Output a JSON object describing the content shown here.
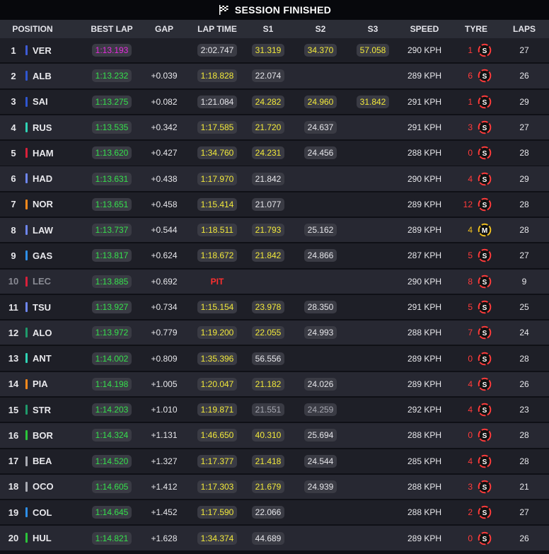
{
  "title": "SESSION FINISHED",
  "icons": {
    "title": "checkered-flag-icon",
    "tyre": "tyre-compound-icon"
  },
  "colors": {
    "best_overall": "#e92ae0",
    "personal_best": "#35e04c",
    "improved": "#f2e93a",
    "pit": "#ff2f2f",
    "soft": "#ff3b3b",
    "medium": "#f0c020"
  },
  "columns": {
    "position": "POSITION",
    "best_lap": "BEST LAP",
    "gap": "GAP",
    "lap_time": "LAP TIME",
    "s1": "S1",
    "s2": "S2",
    "s3": "S3",
    "speed": "SPEED",
    "tyre": "TYRE",
    "laps": "LAPS"
  },
  "rows": [
    {
      "pos": "1",
      "team": "#3e5bd6",
      "driver": "VER",
      "best": "1:13.193",
      "best_c": "purple",
      "gap": "",
      "lap": "2:02.747",
      "lap_c": "white",
      "s1": "31.319",
      "s1_c": "yellow",
      "s2": "34.370",
      "s2_c": "yellow",
      "s3": "57.058",
      "s3_c": "yellow",
      "speed": "290 KPH",
      "tyre_count": "1",
      "tyre": "S",
      "laps": "27"
    },
    {
      "pos": "2",
      "team": "#2f56d0",
      "driver": "ALB",
      "best": "1:13.232",
      "best_c": "green",
      "gap": "+0.039",
      "lap": "1:18.828",
      "lap_c": "yellow",
      "s1": "22.074",
      "s1_c": "white",
      "s2": "",
      "s2_c": "white",
      "s3": "",
      "s3_c": "white",
      "speed": "289 KPH",
      "tyre_count": "6",
      "tyre": "S",
      "laps": "26"
    },
    {
      "pos": "3",
      "team": "#2f56d0",
      "driver": "SAI",
      "best": "1:13.275",
      "best_c": "green",
      "gap": "+0.082",
      "lap": "1:21.084",
      "lap_c": "white",
      "s1": "24.282",
      "s1_c": "yellow",
      "s2": "24.960",
      "s2_c": "yellow",
      "s3": "31.842",
      "s3_c": "yellow",
      "speed": "291 KPH",
      "tyre_count": "1",
      "tyre": "S",
      "laps": "29"
    },
    {
      "pos": "4",
      "team": "#2fd3b5",
      "driver": "RUS",
      "best": "1:13.535",
      "best_c": "green",
      "gap": "+0.342",
      "lap": "1:17.585",
      "lap_c": "yellow",
      "s1": "21.720",
      "s1_c": "yellow",
      "s2": "24.637",
      "s2_c": "white",
      "s3": "",
      "s3_c": "white",
      "speed": "291 KPH",
      "tyre_count": "3",
      "tyre": "S",
      "laps": "27"
    },
    {
      "pos": "5",
      "team": "#d8203a",
      "driver": "HAM",
      "best": "1:13.620",
      "best_c": "green",
      "gap": "+0.427",
      "lap": "1:34.760",
      "lap_c": "yellow",
      "s1": "24.231",
      "s1_c": "yellow",
      "s2": "24.456",
      "s2_c": "white",
      "s3": "",
      "s3_c": "white",
      "speed": "288 KPH",
      "tyre_count": "0",
      "tyre": "S",
      "laps": "28"
    },
    {
      "pos": "6",
      "team": "#6e86ee",
      "driver": "HAD",
      "best": "1:13.631",
      "best_c": "green",
      "gap": "+0.438",
      "lap": "1:17.970",
      "lap_c": "yellow",
      "s1": "21.842",
      "s1_c": "white",
      "s2": "",
      "s2_c": "white",
      "s3": "",
      "s3_c": "white",
      "speed": "290 KPH",
      "tyre_count": "4",
      "tyre": "S",
      "laps": "29"
    },
    {
      "pos": "7",
      "team": "#ff8a1c",
      "driver": "NOR",
      "best": "1:13.651",
      "best_c": "green",
      "gap": "+0.458",
      "lap": "1:15.414",
      "lap_c": "yellow",
      "s1": "21.077",
      "s1_c": "white",
      "s2": "",
      "s2_c": "white",
      "s3": "",
      "s3_c": "white",
      "speed": "289 KPH",
      "tyre_count": "12",
      "tyre": "S",
      "laps": "28"
    },
    {
      "pos": "8",
      "team": "#6e86ee",
      "driver": "LAW",
      "best": "1:13.737",
      "best_c": "green",
      "gap": "+0.544",
      "lap": "1:18.511",
      "lap_c": "yellow",
      "s1": "21.793",
      "s1_c": "yellow",
      "s2": "25.162",
      "s2_c": "white",
      "s3": "",
      "s3_c": "white",
      "speed": "289 KPH",
      "tyre_count": "4",
      "tyre": "M",
      "laps": "28"
    },
    {
      "pos": "9",
      "team": "#2e8fe8",
      "driver": "GAS",
      "best": "1:13.817",
      "best_c": "green",
      "gap": "+0.624",
      "lap": "1:18.672",
      "lap_c": "yellow",
      "s1": "21.842",
      "s1_c": "yellow",
      "s2": "24.866",
      "s2_c": "white",
      "s3": "",
      "s3_c": "white",
      "speed": "287 KPH",
      "tyre_count": "5",
      "tyre": "S",
      "laps": "27"
    },
    {
      "pos": "10",
      "team": "#d8203a",
      "driver": "LEC",
      "best": "1:13.885",
      "best_c": "green",
      "gap": "+0.692",
      "lap": "PIT",
      "lap_c": "red",
      "s1": "",
      "s1_c": "white",
      "s2": "",
      "s2_c": "white",
      "s3": "",
      "s3_c": "white",
      "speed": "290 KPH",
      "tyre_count": "8",
      "tyre": "S",
      "laps": "9",
      "out": true
    },
    {
      "pos": "11",
      "team": "#6e86ee",
      "driver": "TSU",
      "best": "1:13.927",
      "best_c": "green",
      "gap": "+0.734",
      "lap": "1:15.154",
      "lap_c": "yellow",
      "s1": "23.978",
      "s1_c": "yellow",
      "s2": "28.350",
      "s2_c": "white",
      "s3": "",
      "s3_c": "white",
      "speed": "291 KPH",
      "tyre_count": "5",
      "tyre": "S",
      "laps": "25"
    },
    {
      "pos": "12",
      "team": "#1f9a6b",
      "driver": "ALO",
      "best": "1:13.972",
      "best_c": "green",
      "gap": "+0.779",
      "lap": "1:19.200",
      "lap_c": "yellow",
      "s1": "22.055",
      "s1_c": "yellow",
      "s2": "24.993",
      "s2_c": "white",
      "s3": "",
      "s3_c": "white",
      "speed": "288 KPH",
      "tyre_count": "7",
      "tyre": "S",
      "laps": "24"
    },
    {
      "pos": "13",
      "team": "#2fd3b5",
      "driver": "ANT",
      "best": "1:14.002",
      "best_c": "green",
      "gap": "+0.809",
      "lap": "1:35.396",
      "lap_c": "yellow",
      "s1": "56.556",
      "s1_c": "white",
      "s2": "",
      "s2_c": "white",
      "s3": "",
      "s3_c": "white",
      "speed": "289 KPH",
      "tyre_count": "0",
      "tyre": "S",
      "laps": "28"
    },
    {
      "pos": "14",
      "team": "#ff8a1c",
      "driver": "PIA",
      "best": "1:14.198",
      "best_c": "green",
      "gap": "+1.005",
      "lap": "1:20.047",
      "lap_c": "yellow",
      "s1": "21.182",
      "s1_c": "yellow",
      "s2": "24.026",
      "s2_c": "white",
      "s3": "",
      "s3_c": "white",
      "speed": "289 KPH",
      "tyre_count": "4",
      "tyre": "S",
      "laps": "26"
    },
    {
      "pos": "15",
      "team": "#1f9a6b",
      "driver": "STR",
      "best": "1:14.203",
      "best_c": "green",
      "gap": "+1.010",
      "lap": "1:19.871",
      "lap_c": "yellow",
      "s1": "21.551",
      "s1_c": "grey",
      "s2": "24.259",
      "s2_c": "grey",
      "s3": "",
      "s3_c": "white",
      "speed": "292 KPH",
      "tyre_count": "4",
      "tyre": "S",
      "laps": "23"
    },
    {
      "pos": "16",
      "team": "#2bc43a",
      "driver": "BOR",
      "best": "1:14.324",
      "best_c": "green",
      "gap": "+1.131",
      "lap": "1:46.650",
      "lap_c": "yellow",
      "s1": "40.310",
      "s1_c": "yellow",
      "s2": "25.694",
      "s2_c": "white",
      "s3": "",
      "s3_c": "white",
      "speed": "288 KPH",
      "tyre_count": "0",
      "tyre": "S",
      "laps": "28"
    },
    {
      "pos": "17",
      "team": "#a9abb3",
      "driver": "BEA",
      "best": "1:14.520",
      "best_c": "green",
      "gap": "+1.327",
      "lap": "1:17.377",
      "lap_c": "yellow",
      "s1": "21.418",
      "s1_c": "yellow",
      "s2": "24.544",
      "s2_c": "white",
      "s3": "",
      "s3_c": "white",
      "speed": "285 KPH",
      "tyre_count": "4",
      "tyre": "S",
      "laps": "28"
    },
    {
      "pos": "18",
      "team": "#a9abb3",
      "driver": "OCO",
      "best": "1:14.605",
      "best_c": "green",
      "gap": "+1.412",
      "lap": "1:17.303",
      "lap_c": "yellow",
      "s1": "21.679",
      "s1_c": "yellow",
      "s2": "24.939",
      "s2_c": "white",
      "s3": "",
      "s3_c": "white",
      "speed": "288 KPH",
      "tyre_count": "3",
      "tyre": "S",
      "laps": "21"
    },
    {
      "pos": "19",
      "team": "#2e8fe8",
      "driver": "COL",
      "best": "1:14.645",
      "best_c": "green",
      "gap": "+1.452",
      "lap": "1:17.590",
      "lap_c": "yellow",
      "s1": "22.066",
      "s1_c": "white",
      "s2": "",
      "s2_c": "white",
      "s3": "",
      "s3_c": "white",
      "speed": "288 KPH",
      "tyre_count": "2",
      "tyre": "S",
      "laps": "27"
    },
    {
      "pos": "20",
      "team": "#2bc43a",
      "driver": "HUL",
      "best": "1:14.821",
      "best_c": "green",
      "gap": "+1.628",
      "lap": "1:34.374",
      "lap_c": "yellow",
      "s1": "44.689",
      "s1_c": "white",
      "s2": "",
      "s2_c": "white",
      "s3": "",
      "s3_c": "white",
      "speed": "289 KPH",
      "tyre_count": "0",
      "tyre": "S",
      "laps": "26"
    }
  ]
}
